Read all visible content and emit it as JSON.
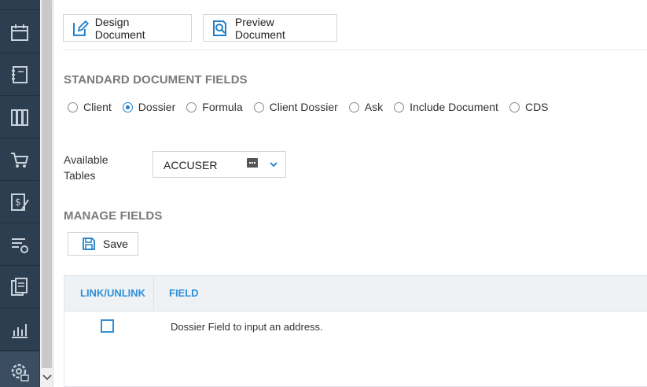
{
  "toolbar": {
    "design_label": "Design Document",
    "preview_label": "Preview Document"
  },
  "standard_fields": {
    "title": "STANDARD DOCUMENT FIELDS",
    "options": [
      "Client",
      "Dossier",
      "Formula",
      "Client Dossier",
      "Ask",
      "Include Document",
      "CDS"
    ],
    "selected": "Dossier"
  },
  "available_tables": {
    "label": "Available Tables",
    "value": "ACCUSER"
  },
  "manage_fields": {
    "title": "MANAGE FIELDS",
    "save_label": "Save"
  },
  "grid": {
    "columns": [
      "LINK/UNLINK",
      "FIELD"
    ],
    "rows": [
      {
        "linked": false,
        "field": "Dossier Field to input an address."
      }
    ]
  },
  "sidebar": {
    "icons": [
      "calendar-icon",
      "notebook-icon",
      "library-icon",
      "cart-icon",
      "billing-icon",
      "list-settings-icon",
      "documents-icon",
      "reports-icon",
      "settings-icon"
    ]
  },
  "colors": {
    "sidebar_bg": "#2d3e50",
    "accent": "#2f8fd7",
    "section_title": "#7a7a7a"
  }
}
